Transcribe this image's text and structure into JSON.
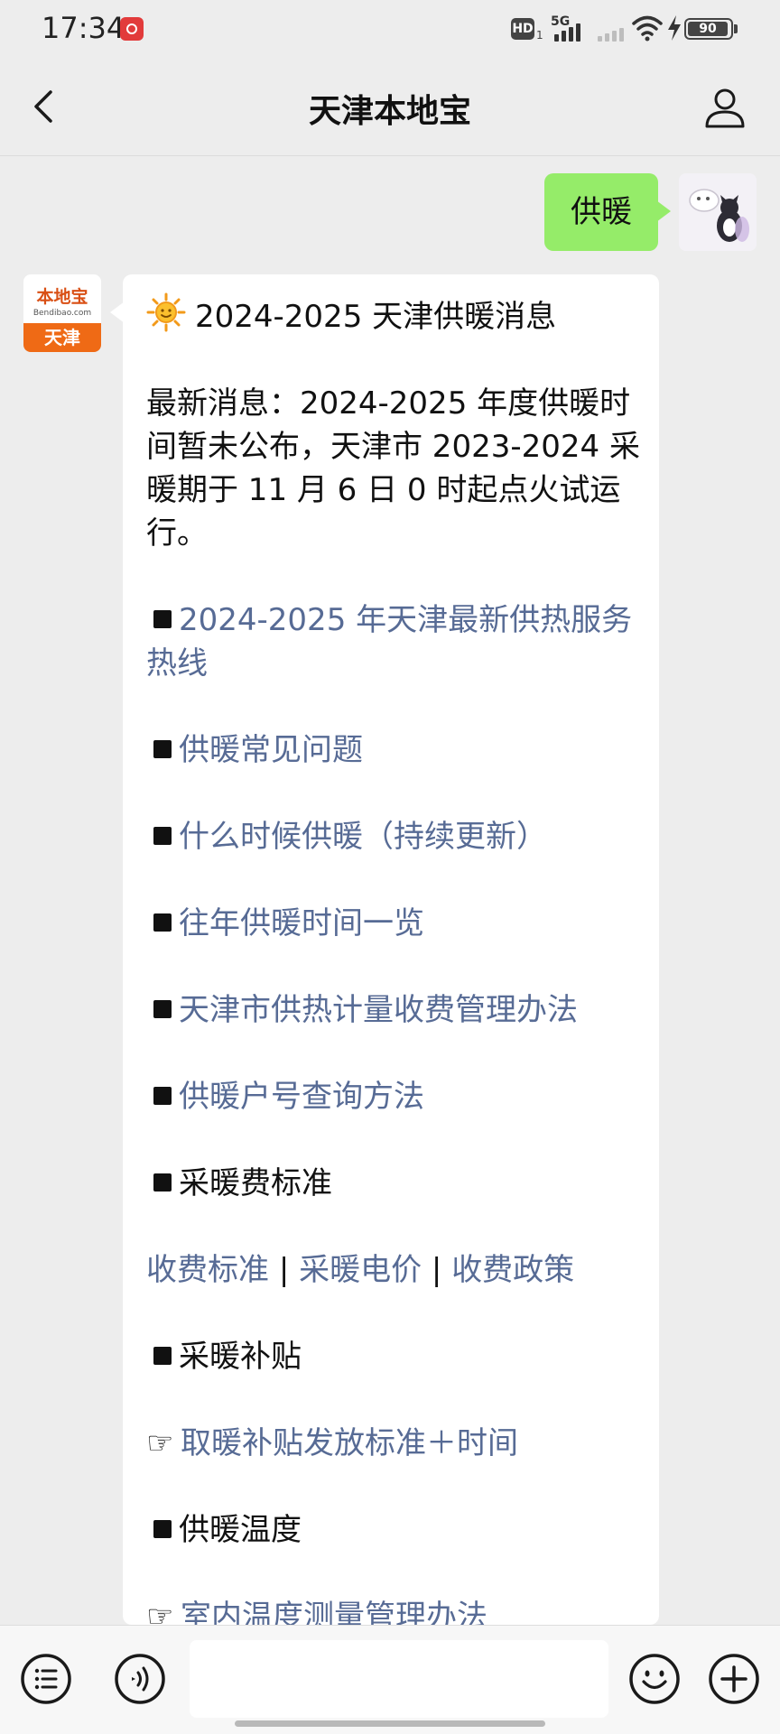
{
  "status_bar": {
    "time": "17:34",
    "network": "5G",
    "hd_label": "HD",
    "hd_sub": "1",
    "battery": "90"
  },
  "header": {
    "title": "天津本地宝"
  },
  "messages": {
    "user_text": "供暖"
  },
  "bot": {
    "avatar_logo": "本地宝",
    "avatar_url": "Bendibao.com",
    "avatar_city": "天津",
    "card": {
      "heading": "2024-2025 天津供暖消息",
      "news": "最新消息：2024-2025 年度供暖时间暂未公布，天津市 2023-2024 采暖期于 11 月 6 日 0 时起点火试运行。",
      "links": [
        "2024-2025 年天津最新供热服务热线",
        "供暖常见问题",
        "什么时候供暖（持续更新）",
        "往年供暖时间一览",
        "天津市供热计量收费管理办法",
        "供暖户号查询方法"
      ],
      "section_fee": "采暖费标准",
      "fee_links": [
        "收费标准",
        "采暖电价",
        "收费政策"
      ],
      "fee_separator": "|",
      "section_subsidy": "采暖补贴",
      "subsidy_link": "取暖补贴发放标准＋时间",
      "section_temp": "供暖温度",
      "temp_link": "室内温度测量管理办法"
    }
  },
  "input": {
    "value": ""
  },
  "colors": {
    "link": "#576b95",
    "user_bubble": "#95ec69",
    "background": "#ededed"
  },
  "icons": [
    "back-arrow-icon",
    "profile-icon",
    "sun-icon",
    "hand-pointer-icon",
    "menu-list-icon",
    "voice-icon",
    "emoji-icon",
    "plus-icon"
  ]
}
